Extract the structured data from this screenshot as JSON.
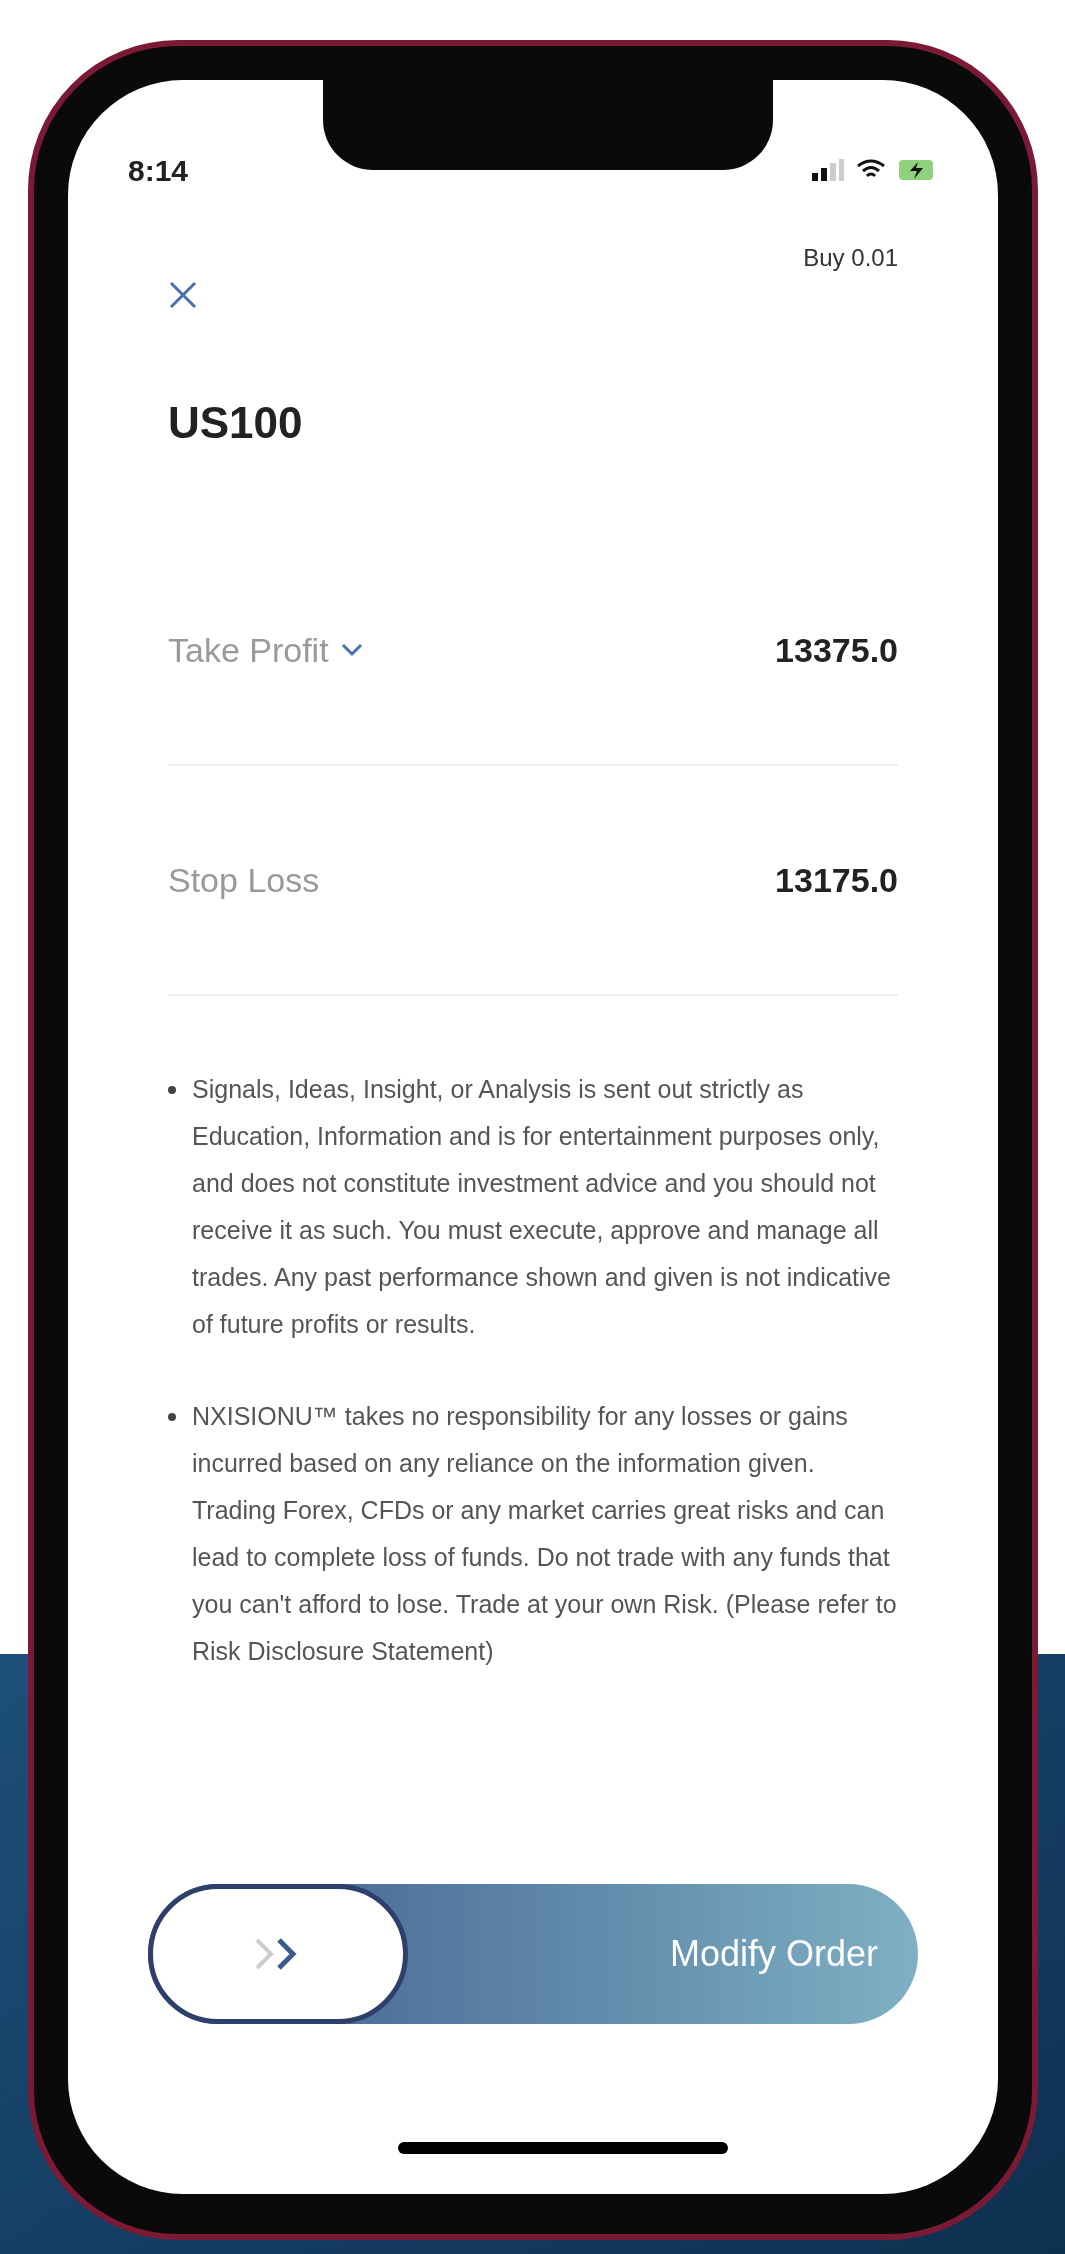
{
  "status_bar": {
    "time": "8:14"
  },
  "header": {
    "order": "Buy 0.01"
  },
  "symbol": "US100",
  "fields": [
    {
      "label": "Take Profit",
      "value": "13375.0",
      "dropdown": true
    },
    {
      "label": "Stop Loss",
      "value": "13175.0",
      "dropdown": false
    }
  ],
  "disclaimer": [
    "Signals, Ideas, Insight, or Analysis is sent out strictly as Education, Information and is for entertainment purposes only, and does not constitute investment advice and you should not receive it as such. You must execute, approve and manage all trades. Any past performance shown and given is not indicative of future profits or results.",
    "NXISIONU™ takes no responsibility for any losses or gains incurred based on any reliance on the information given. Trading Forex, CFDs or any market carries great risks and can lead to complete loss of funds. Do not trade with any funds that you can't afford to lose. Trade at your own Risk. (Please refer to Risk Disclosure Statement)"
  ],
  "swipe": {
    "label": "Modify Order",
    "level": 0
  }
}
